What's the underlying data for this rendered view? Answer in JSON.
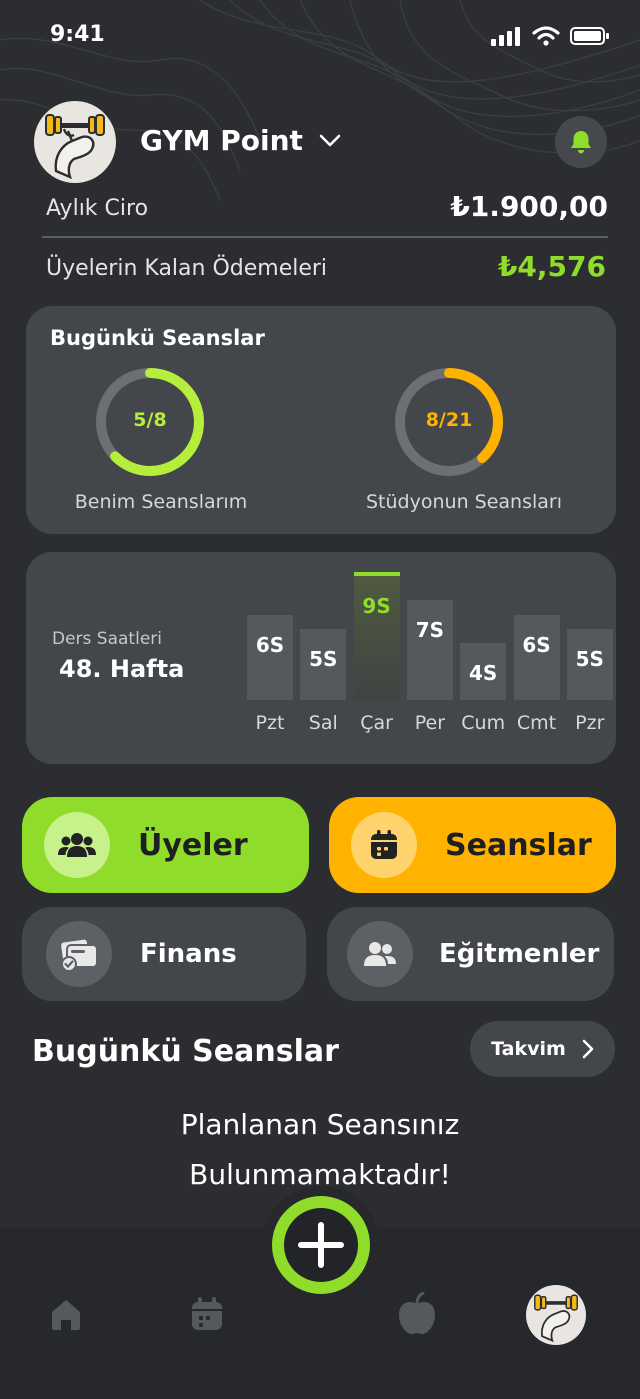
{
  "status_bar": {
    "time": "9:41"
  },
  "header": {
    "gym_name": "GYM Point",
    "monthly_revenue_label": "Aylık Ciro",
    "monthly_revenue_value": "₺1.900,00",
    "remaining_payments_label": "Üyelerin Kalan Ödemeleri",
    "remaining_payments_value": "₺4,576"
  },
  "today_sessions_card": {
    "title": "Bugünkü Seanslar",
    "my_sessions": {
      "label": "Benim Seanslarım",
      "text": "5/8",
      "fraction": 0.625,
      "color": "#b6ee3c"
    },
    "studio_sessions": {
      "label": "Stüdyonun Seansları",
      "text": "8/21",
      "fraction": 0.381,
      "color": "#ffb300"
    }
  },
  "hours_card": {
    "subtitle": "Ders Saatleri",
    "week": "48. Hafta",
    "max_hours": 9,
    "days": [
      {
        "day": "Pzt",
        "value": 6,
        "label": "6S"
      },
      {
        "day": "Sal",
        "value": 5,
        "label": "5S"
      },
      {
        "day": "Çar",
        "value": 9,
        "label": "9S",
        "active": true
      },
      {
        "day": "Per",
        "value": 7,
        "label": "7S"
      },
      {
        "day": "Cum",
        "value": 4,
        "label": "4S"
      },
      {
        "day": "Cmt",
        "value": 6,
        "label": "6S"
      },
      {
        "day": "Pzr",
        "value": 5,
        "label": "5S"
      }
    ]
  },
  "menu": {
    "members": "Üyeler",
    "sessions": "Seanslar",
    "finance": "Finans",
    "trainers": "Eğitmenler"
  },
  "today_section": {
    "title": "Bugünkü Seanslar",
    "calendar_button": "Takvim",
    "empty_line1": "Planlanan Seansınız",
    "empty_line2": "Bulunmamaktadır!"
  },
  "colors": {
    "accent_green": "#8fdc2a",
    "accent_yellow": "#ffb300",
    "card": "#43464b",
    "background": "#2b2d30"
  },
  "icons": {
    "bell": "bell-icon",
    "members": "users-group-icon",
    "sessions": "calendar-icon",
    "finance": "wallet-check-icon",
    "trainers": "users-icon",
    "home": "home-icon",
    "calendar": "calendar-icon",
    "nutrition": "apple-icon",
    "add": "plus-icon"
  }
}
